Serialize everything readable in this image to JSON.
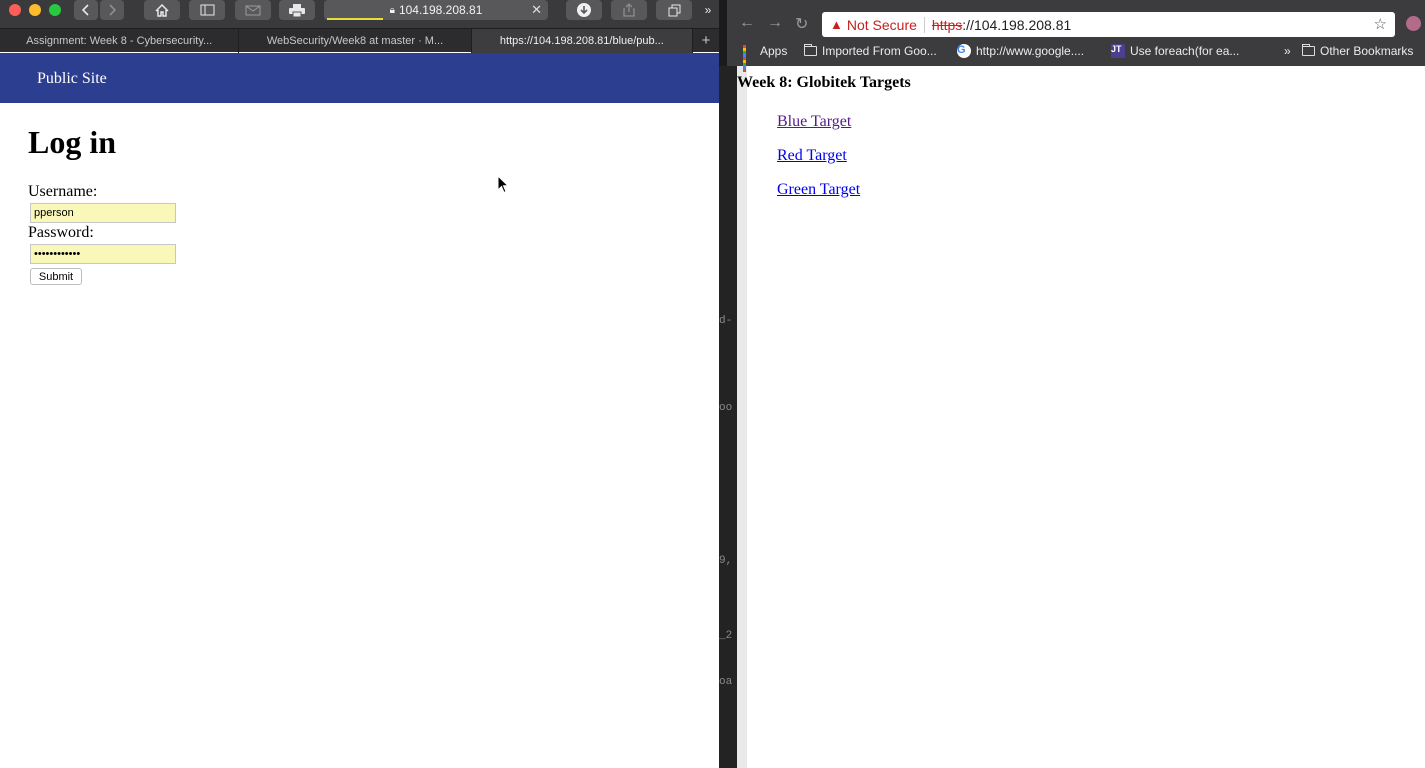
{
  "colors": {
    "site_nav_bg": "#2c3e8f",
    "autofill_bg": "#f9f8b9",
    "not_secure_red": "#c5221f",
    "link_visited": "#551a8b",
    "link_unvisited": "#0000ee"
  },
  "safari": {
    "address": "104.198.208.81",
    "tabs": [
      {
        "label": "Assignment: Week 8 - Cybersecurity...",
        "active": false
      },
      {
        "label": "WebSecurity/Week8 at master · M...",
        "active": false
      },
      {
        "label": "https://104.198.208.81/blue/pub...",
        "active": true
      }
    ],
    "icons": [
      "back-icon",
      "forward-icon",
      "home-icon",
      "sidebar-icon",
      "mail-icon",
      "print-icon",
      "lock-icon",
      "download-icon",
      "share-icon",
      "tabs-overview-icon",
      "overflow-icon",
      "new-tab-icon"
    ]
  },
  "site": {
    "nav_title": "Public Site",
    "heading": "Log in",
    "username_label": "Username:",
    "username_value": "pperson",
    "password_label": "Password:",
    "password_value": "••••••••••••",
    "submit_label": "Submit"
  },
  "background_fragments": [
    "d-",
    "oo",
    "9,",
    "_2",
    "oa"
  ],
  "chrome": {
    "security_label": "Not Secure",
    "scheme": "https",
    "url_rest": "://104.198.208.81",
    "bookmarks": [
      {
        "label": "Apps",
        "icon": "apps-grid-icon"
      },
      {
        "label": "Imported From Goo...",
        "icon": "folder-icon"
      },
      {
        "label": "http://www.google....",
        "icon": "google-icon"
      },
      {
        "label": "Use foreach(for ea...",
        "icon": "favicon-icon"
      },
      {
        "label": "»",
        "icon": "overflow-icon"
      },
      {
        "label": "Other Bookmarks",
        "icon": "folder-icon"
      }
    ]
  },
  "targets_page": {
    "title": "Week 8: Globitek Targets",
    "links": [
      {
        "label": "Blue Target",
        "visited": true
      },
      {
        "label": "Red Target",
        "visited": false
      },
      {
        "label": "Green Target",
        "visited": false
      }
    ]
  }
}
